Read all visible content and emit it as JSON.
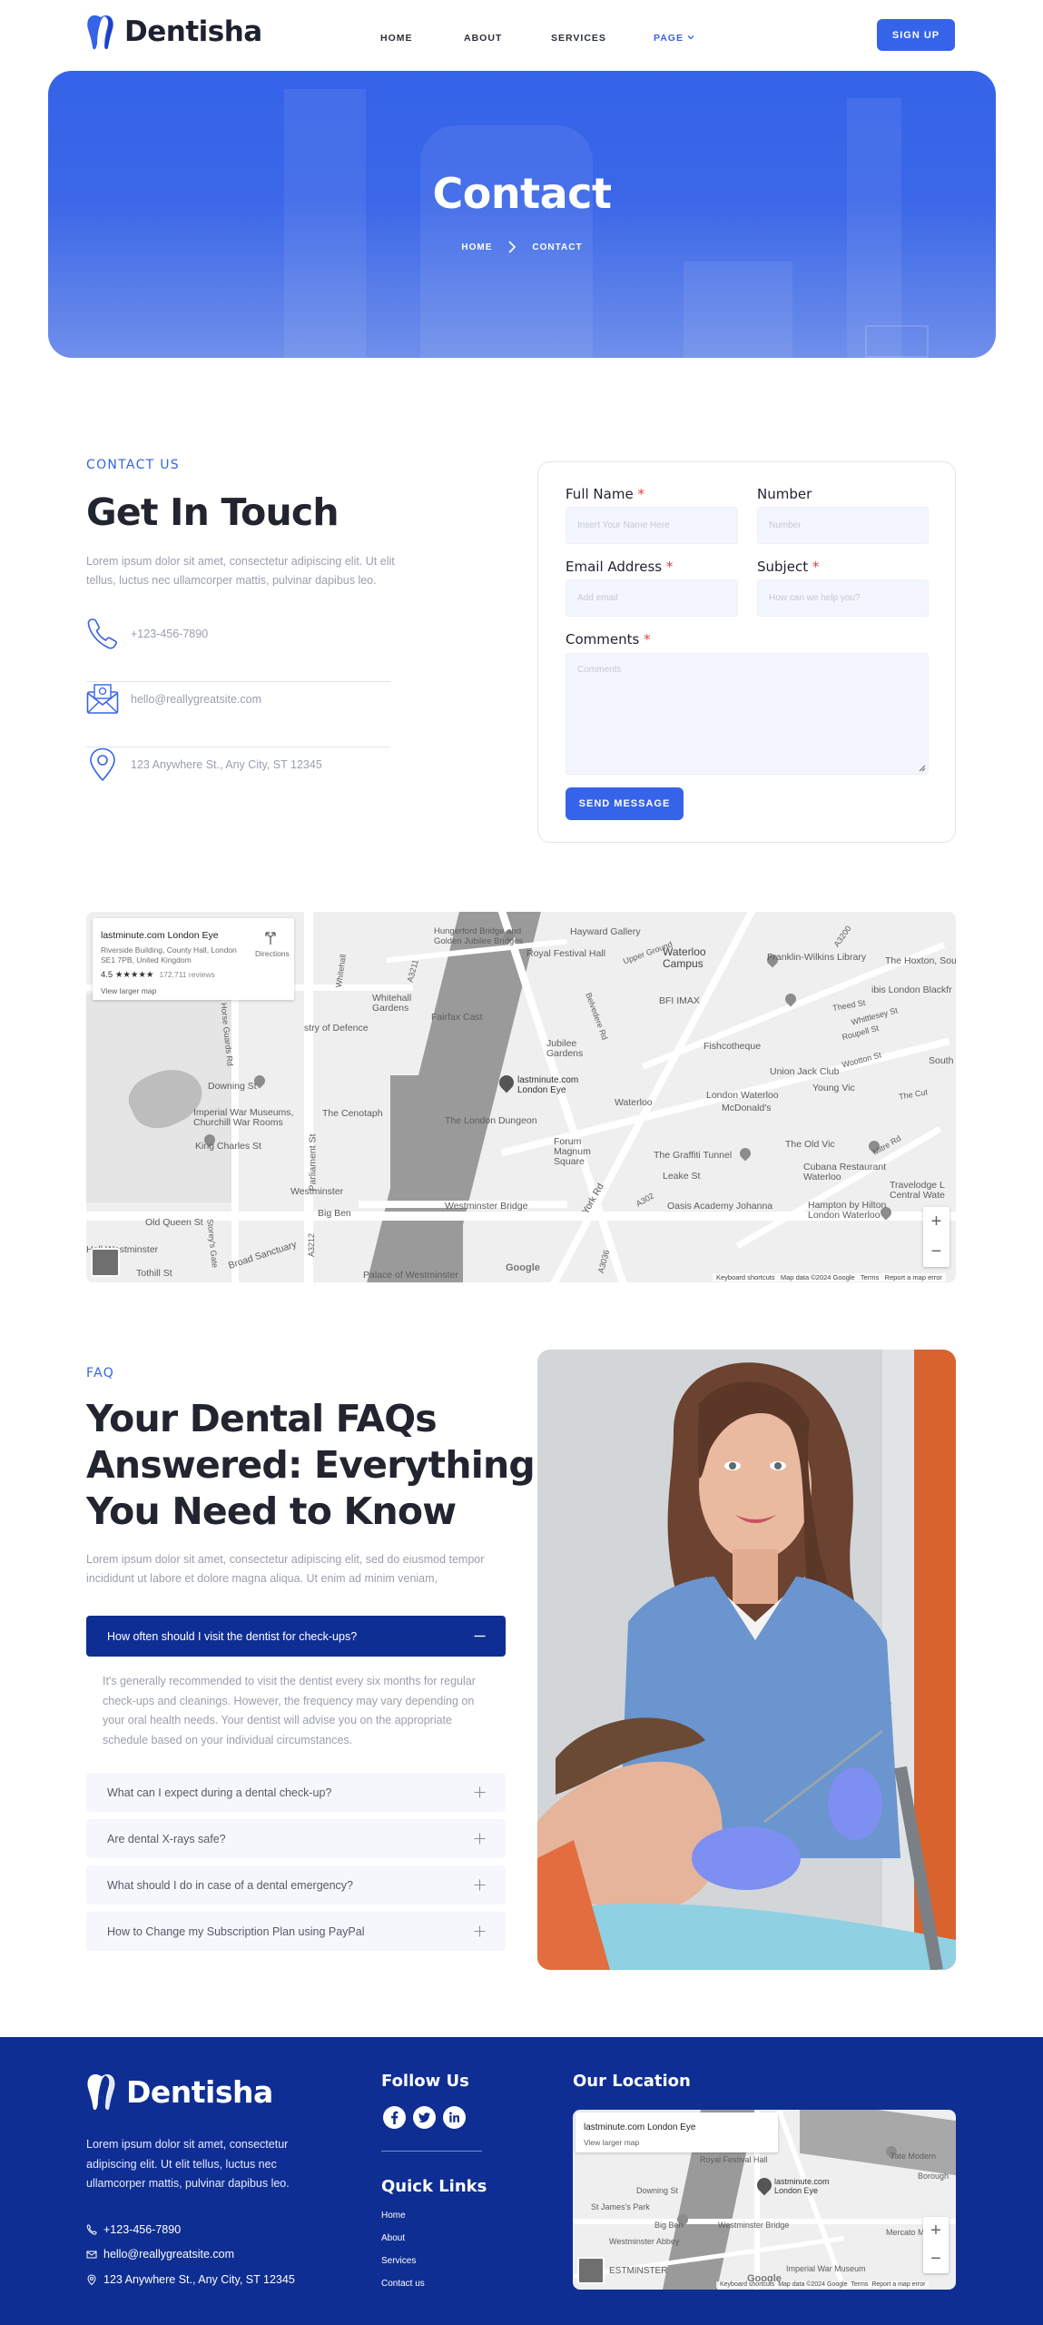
{
  "brand": {
    "name": "Dentisha",
    "accent": "#3563e9",
    "dark_blue": "#0f2e93"
  },
  "nav": {
    "links": [
      {
        "label": "HOME"
      },
      {
        "label": "ABOUT"
      },
      {
        "label": "SERVICES"
      },
      {
        "label": "PAGE"
      }
    ],
    "signup_label": "SIGN UP"
  },
  "hero": {
    "title": "Contact",
    "breadcrumb": [
      "HOME",
      "CONTACT"
    ]
  },
  "contact": {
    "eyebrow": "CONTACT US",
    "heading": "Get In Touch",
    "description": "Lorem ipsum dolor sit amet, consectetur adipiscing elit. Ut elit tellus, luctus nec ullamcorper mattis, pulvinar dapibus leo.",
    "phone": "+123-456-7890",
    "email": "hello@reallygreatsite.com",
    "address": "123 Anywhere St., Any City, ST 12345"
  },
  "form": {
    "full_name": {
      "label": "Full Name",
      "required": "*",
      "placeholder": "Insert Your Name Here"
    },
    "number": {
      "label": "Number",
      "placeholder": "Number"
    },
    "email": {
      "label": "Email Address",
      "required": "*",
      "placeholder": "Add email"
    },
    "subject": {
      "label": "Subject",
      "required": "*",
      "placeholder": "How can we help you?"
    },
    "comments": {
      "label": "Comments",
      "required": "*",
      "placeholder": "Comments"
    },
    "submit_label": "SEND MESSAGE"
  },
  "map": {
    "place_name": "lastminute.com London Eye",
    "place_address": "Riverside Building, County Hall, London SE1 7PB, United Kingdom",
    "rating": "4.5 ★★★★★",
    "reviews": "172,711 reviews",
    "larger_map": "View larger map",
    "directions": "Directions",
    "pin_label": "lastminute.com London Eye",
    "google": "Google",
    "attribution": [
      "Keyboard shortcuts",
      "Map data ©2024 Google",
      "Terms",
      "Report a map error"
    ],
    "zoom_in": "+",
    "zoom_out": "−",
    "street_labels": {
      "hungerford": "Hungerford Bridge and Golden Jubilee Bridges",
      "hayward": "Hayward Gallery",
      "royal_festival": "Royal Festival Hall",
      "waterloo_campus": "Waterloo Campus",
      "franklin": "Franklin-Wilkins Library",
      "hoxton": "The Hoxton, Sou",
      "whitehall": "Whitehall Gardens",
      "defence": "stry of Defence",
      "fairfax": "Fairfax Cast",
      "jubilee": "Jubilee Gardens",
      "bfi": "BFI IMAX",
      "fishcotheque": "Fishcotheque",
      "union_jack": "Union Jack Club",
      "ibis": "ibis London Blackfr",
      "cenotaph": "The Cenotaph",
      "downing": "Downing St",
      "war_museums": "Imperial War Museums, Churchill War Rooms",
      "king_charles": "King Charles St",
      "dungeon": "The London Dungeon",
      "forum": "Forum Magnum Square",
      "waterloo_stn": "Waterloo",
      "lw_station": "London Waterloo",
      "mcdonalds": "McDonald's",
      "young_vic": "Young Vic",
      "old_vic": "The Old Vic",
      "graffiti": "The Graffiti Tunnel",
      "cubana": "Cubana Restaurant Waterloo",
      "leake": "Leake St",
      "westminster": "Westminster",
      "big_ben": "Big Ben",
      "westminster_bridge": "Westminster Bridge",
      "oasis": "Oasis Academy Johanna",
      "hampton": "Hampton by Hilton London Waterloo",
      "travelodge": "Travelodge L Central Wate",
      "palace": "Palace of Westminster",
      "hall_westminster": "Hall Westminster",
      "broad_sanctuary": "Broad Sanctuary",
      "old_queen": "Old Queen St",
      "tothill": "Tothill St",
      "parliament": "Parliament St",
      "york_rd": "York Rd",
      "thepit": "Theed St",
      "whittlesey": "Whittlesey St",
      "roupell": "Roupell St",
      "wootton": "Wootton St",
      "south": "South",
      "the_cut": "The Cut",
      "mitre": "Mitre Rd",
      "a3200": "A3200",
      "a3212": "A3212",
      "a3036": "A3036",
      "a302": "A302",
      "a3211": "A3211",
      "whitehall_st": "Whitehall",
      "horse_guards": "Horse Guards Rd",
      "storeys": "Storey's Gate",
      "belvedere": "Belvedere Rd",
      "upper_ground": "Upper Ground"
    }
  },
  "faq": {
    "eyebrow": "FAQ",
    "heading_lines": [
      "Your Dental FAQs",
      "Answered: Everything",
      "You Need to Know"
    ],
    "description": "Lorem ipsum dolor sit amet, consectetur adipiscing elit, sed do eiusmod tempor incididunt ut labore et dolore magna aliqua. Ut enim ad minim veniam,",
    "open_question": "How often should I visit the dentist for check-ups?",
    "open_answer": "It's generally recommended to visit the dentist every six months for regular check-ups and cleanings. However, the frequency may vary depending on your oral health needs. Your dentist will advise you on the appropriate schedule based on your individual circumstances.",
    "questions": [
      "What can I expect during a dental check-up?",
      "Are dental X-rays safe?",
      "What should I do in case of a dental emergency?",
      "How to Change my Subscription Plan using PayPal"
    ]
  },
  "footer": {
    "brand": "Dentisha",
    "description": "Lorem ipsum dolor sit amet, consectetur adipiscing elit. Ut elit tellus, luctus nec ullamcorper mattis, pulvinar dapibus leo.",
    "phone": "+123-456-7890",
    "email": "hello@reallygreatsite.com",
    "address": "123 Anywhere St., Any City, ST 12345",
    "follow_heading": "Follow Us",
    "quick_links_heading": "Quick Links",
    "quick_links": [
      "Home",
      "About",
      "Services",
      "Contact us"
    ],
    "location_heading": "Our Location",
    "map": {
      "place_name": "lastminute.com London Eye",
      "larger_map": "View larger map",
      "pin_label": "lastminute.com London Eye",
      "labels": {
        "royal": "Royal Festival Hall",
        "tate": "Tate Modern",
        "borough": "Borough",
        "downing": "Downing St",
        "james_park": "St James's Park",
        "big_ben": "Big Ben",
        "wb": "Westminster Bridge",
        "abbey": "Westminster Abbey",
        "mercato": "Mercato Metropo",
        "westminster": "ESTMINSTER",
        "war_museum": "Imperial War Museum"
      },
      "google": "Google",
      "attribution": [
        "Keyboard shortcuts",
        "Map data ©2024 Google",
        "Terms",
        "Report a map error"
      ]
    }
  }
}
